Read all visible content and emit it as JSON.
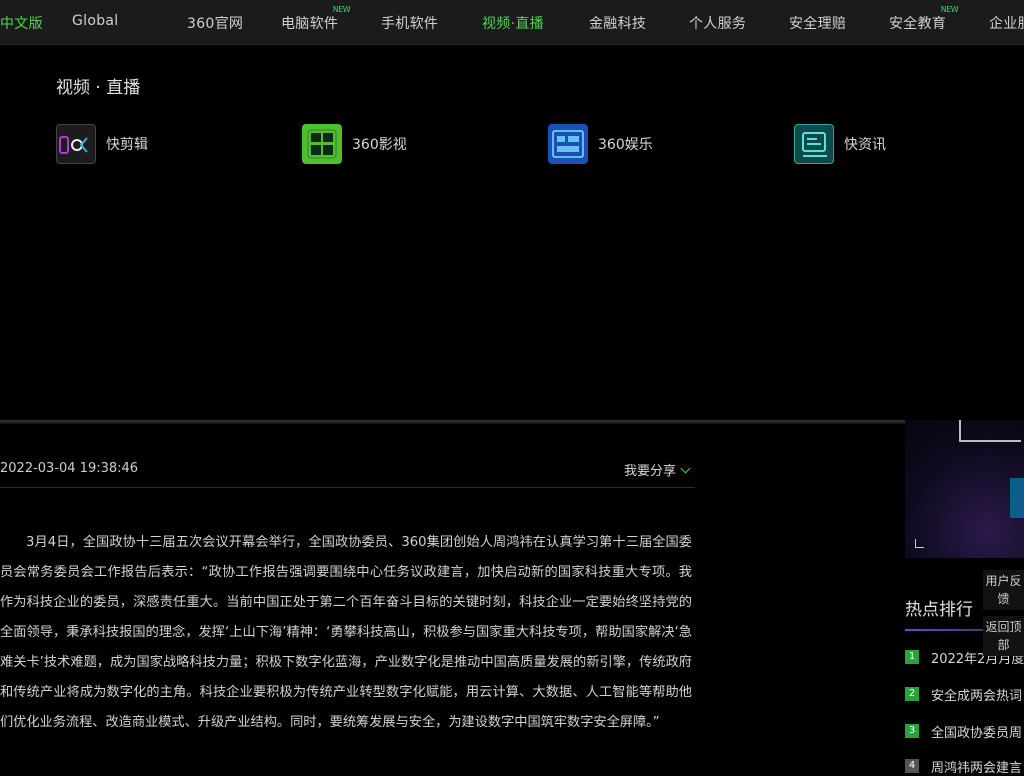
{
  "topnav": {
    "lang": "中文版",
    "items": [
      "Global",
      "360官网",
      "电脑软件",
      "手机软件",
      "视频·直播",
      "金融科技",
      "个人服务",
      "安全理赔",
      "安全教育",
      "企业服务"
    ],
    "new_badge": "NEW"
  },
  "dropdown": {
    "title": "视频 · 直播",
    "products": [
      {
        "label": "快剪辑",
        "icon": "kuaijianji-icon"
      },
      {
        "label": "360影视",
        "icon": "yingshi-daquan-icon"
      },
      {
        "label": "360娱乐",
        "icon": "yule-icon"
      },
      {
        "label": "快资讯",
        "icon": "kuaizixun-icon"
      }
    ]
  },
  "article": {
    "date": "2022-03-04 19:38:46",
    "share": "我要分享",
    "body": "3月4日，全国政协十三届五次会议开幕会举行，全国政协委员、360集团创始人周鸿祎在认真学习第十三届全国委员会常务委员会工作报告后表示：“政协工作报告强调要围绕中心任务议政建言，加快启动新的国家科技重大专项。我作为科技企业的委员，深感责任重大。当前中国正处于第二个百年奋斗目标的关键时刻，科技企业一定要始终坚持党的全面领导，秉承科技报国的理念，发挥‘上山下海’精神：‘勇攀科技高山，积极参与国家重大科技专项，帮助国家解决‘急难关卡’技术难题，成为国家战略科技力量；积极下数字化蓝海，产业数字化是推动中国高质量发展的新引擎，传统政府和传统产业将成为数字化的主角。科技企业要积极为传统产业转型数字化赋能，用云计算、大数据、人工智能等帮助他们优化业务流程、改造商业模式、升级产业结构。同时，要统筹发展与安全，为建设数字中国筑牢数字安全屏障。”"
  },
  "hot": {
    "title": "热点排行",
    "items": [
      {
        "rank": "1",
        "title": "2022年2月月度"
      },
      {
        "rank": "2",
        "title": "安全成两会热词"
      },
      {
        "rank": "3",
        "title": "全国政协委员周"
      },
      {
        "rank": "4",
        "title": "周鸿祎两会建言"
      }
    ]
  },
  "float": {
    "feedback": "用户反馈",
    "top": "返回顶部"
  },
  "colors": {
    "accent": "#4fd34f",
    "nav_bg": "#1b1b1b",
    "rank_green": "#2aa33a",
    "hot_line": "#7a3fd6"
  }
}
